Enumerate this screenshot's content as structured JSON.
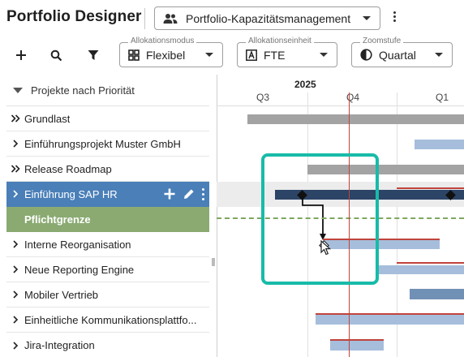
{
  "header": {
    "app_title": "Portfolio Designer",
    "portfolio_select": {
      "value": "Portfolio-Kapazitätsmanagement",
      "icon": "people-icon"
    }
  },
  "toolbar": {
    "allocation_mode": {
      "label": "Allokationsmodus",
      "value": "Flexibel",
      "icon": "grid-icon"
    },
    "allocation_unit": {
      "label": "Allokationseinheit",
      "value": "FTE",
      "icon": "letter-a-icon"
    },
    "zoom": {
      "label": "Zoomstufe",
      "value": "Quartal",
      "icon": "contrast-icon"
    }
  },
  "left_panel": {
    "header_label": "Projekte nach Priorität",
    "rows": [
      {
        "label": "Grundlast",
        "chevron": "double"
      },
      {
        "label": "Einführungsprojekt Muster GmbH",
        "chevron": "single"
      },
      {
        "label": "Release Roadmap",
        "chevron": "double"
      },
      {
        "label": "Einführung SAP HR",
        "chevron": "single",
        "selected": true
      },
      {
        "label": "Pflichtgrenze",
        "chevron": "none",
        "boundary": true
      },
      {
        "label": "Interne Reorganisation",
        "chevron": "single"
      },
      {
        "label": "Neue Reporting Engine",
        "chevron": "single"
      },
      {
        "label": "Mobiler Vertrieb",
        "chevron": "single"
      },
      {
        "label": "Einheitliche Kommunikationsplattfo...",
        "chevron": "single"
      },
      {
        "label": "Jira-Integration",
        "chevron": "single"
      }
    ]
  },
  "timeline": {
    "year": "2025",
    "quarters": [
      "Q3",
      "Q4",
      "Q1"
    ]
  },
  "colors": {
    "selected_row": "#4a7fb8",
    "boundary_row": "#8aaa72",
    "bar_gray": "#a3a3a3",
    "bar_blue": "#a6bedc",
    "bar_dark": "#2c4466",
    "today_line": "#c0443c",
    "highlight": "#18bba8"
  }
}
